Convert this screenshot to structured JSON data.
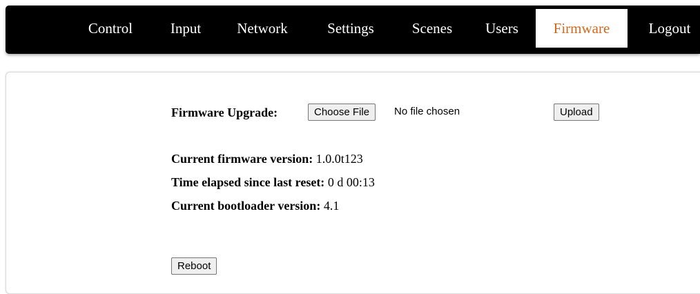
{
  "nav": {
    "items": [
      {
        "label": "Control"
      },
      {
        "label": "Input"
      },
      {
        "label": "Network"
      },
      {
        "label": "Settings"
      },
      {
        "label": "Scenes"
      },
      {
        "label": "Users"
      },
      {
        "label": "Firmware"
      },
      {
        "label": "Logout"
      }
    ],
    "active_label": "Firmware",
    "active_color": "#d2691e",
    "background": "#000000"
  },
  "firmware": {
    "upgrade_label": "Firmware Upgrade:",
    "choose_file_button": "Choose File",
    "file_status": "No file chosen",
    "upload_button": "Upload",
    "current_version_label": "Current firmware version:",
    "current_version_value": "1.0.0t123",
    "elapsed_label": "Time elapsed since last reset:",
    "elapsed_value": "0 d 00:13",
    "bootloader_label": "Current bootloader version:",
    "bootloader_value": "4.1",
    "reboot_button": "Reboot"
  }
}
